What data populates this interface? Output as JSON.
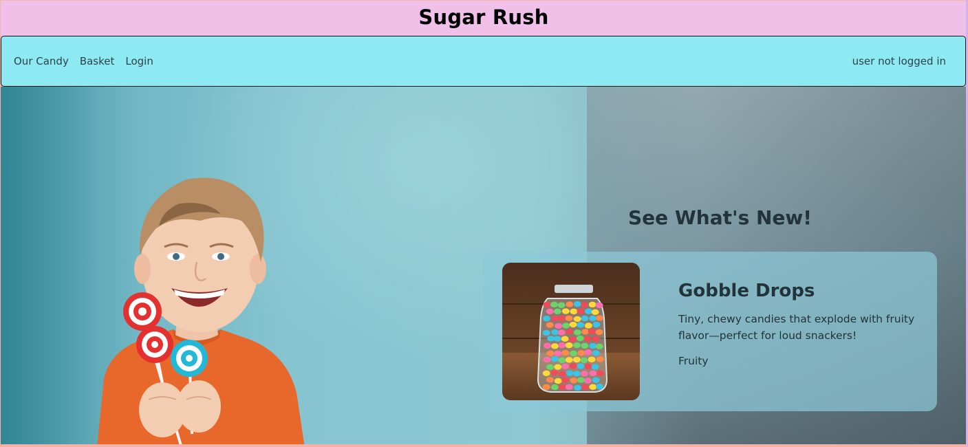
{
  "site": {
    "title": "Sugar Rush"
  },
  "nav": {
    "links": [
      "Our Candy",
      "Basket",
      "Login"
    ],
    "user_status": "user not logged in"
  },
  "hero": {
    "heading": "See What's New!",
    "featured": {
      "name": "Gobble Drops",
      "description": "Tiny, chewy candies that explode with fruity flavor—perfect for loud snackers!",
      "category": "Fruity"
    }
  },
  "colors": {
    "header_bg": "#f0c0e8",
    "navbar_bg": "#8eeaf2",
    "hero_bg": "#86c4d0",
    "card_bg": "#8cc8d7",
    "text_dark": "#22333a"
  }
}
